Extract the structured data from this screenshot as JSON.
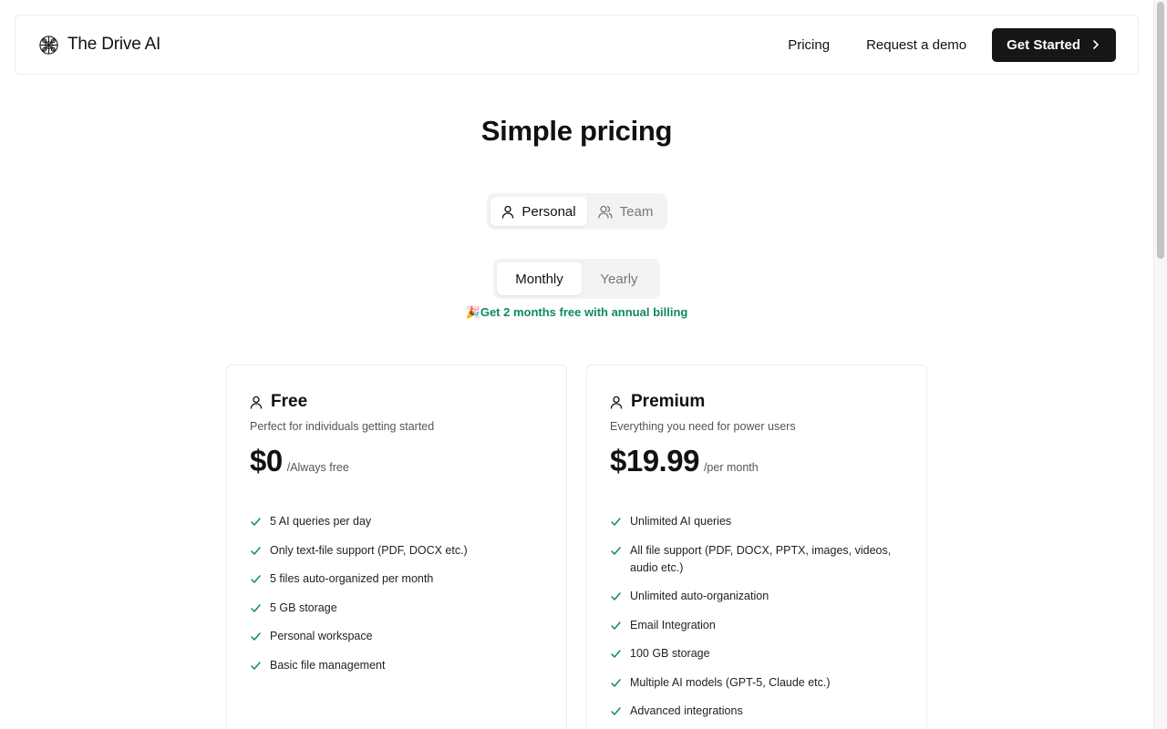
{
  "nav": {
    "brand": "The Drive AI",
    "links": [
      "Pricing",
      "Request a demo"
    ],
    "cta": "Get Started"
  },
  "title": "Simple pricing",
  "plan_type_toggle": {
    "options": [
      "Personal",
      "Team"
    ],
    "selected": "Personal"
  },
  "billing_toggle": {
    "options": [
      "Monthly",
      "Yearly"
    ],
    "selected": "Monthly"
  },
  "promo": {
    "emoji": "🎉",
    "text": "Get 2 months free with annual billing"
  },
  "colors": {
    "accent_green": "#0f8a5f",
    "button_dark": "#161616"
  },
  "plans": [
    {
      "name": "Free",
      "description": "Perfect for individuals getting started",
      "price": "$0",
      "period": "/Always free",
      "features": [
        "5 AI queries per day",
        "Only text-file support (PDF, DOCX etc.)",
        "5 files auto-organized per month",
        "5 GB storage",
        "Personal workspace",
        "Basic file management"
      ]
    },
    {
      "name": "Premium",
      "description": "Everything you need for power users",
      "price": "$19.99",
      "period": "/per month",
      "features": [
        "Unlimited AI queries",
        "All file support (PDF, DOCX, PPTX, images, videos, audio etc.)",
        "Unlimited auto-organization",
        "Email Integration",
        "100 GB storage",
        "Multiple AI models (GPT-5, Claude etc.)",
        "Advanced integrations"
      ]
    }
  ]
}
